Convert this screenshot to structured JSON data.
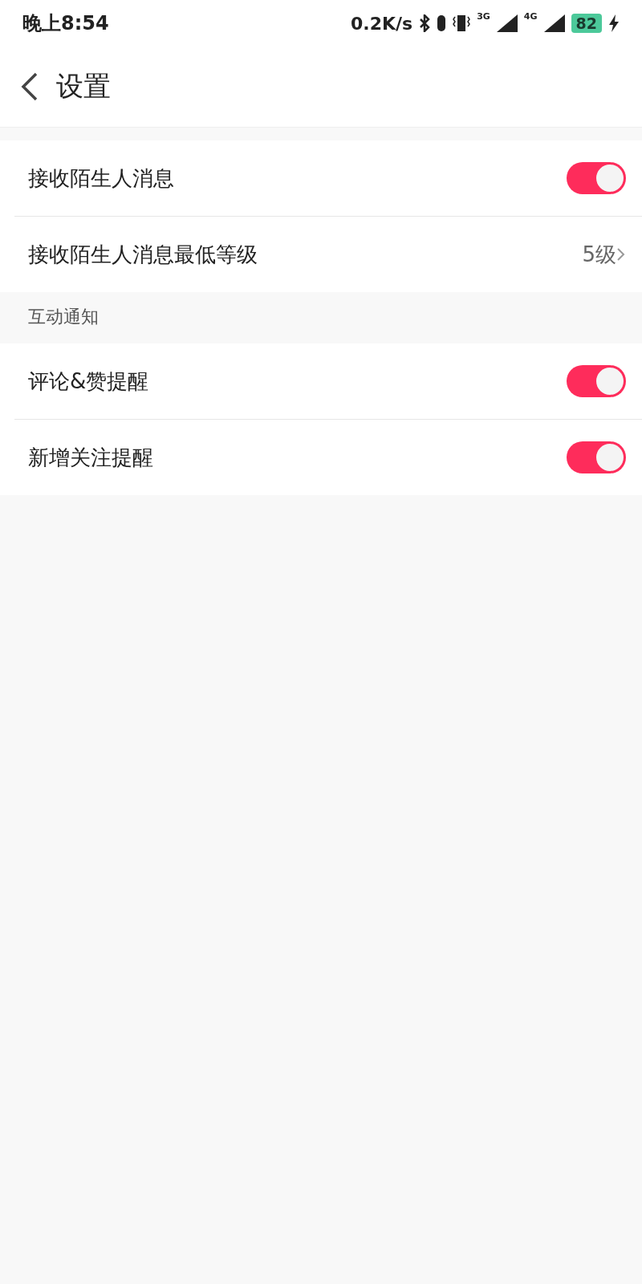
{
  "status_bar": {
    "time": "晚上8:54",
    "speed": "0.2K/s",
    "sim1": "3G",
    "sim2": "4G",
    "battery": "82"
  },
  "header": {
    "title": "设置"
  },
  "groups": [
    {
      "items": [
        {
          "kind": "toggle",
          "label": "接收陌生人消息",
          "on": true
        },
        {
          "kind": "value",
          "label": "接收陌生人消息最低等级",
          "value": "5级"
        }
      ]
    },
    {
      "title": "互动通知",
      "items": [
        {
          "kind": "toggle",
          "label": "评论&赞提醒",
          "on": true
        },
        {
          "kind": "toggle",
          "label": "新增关注提醒",
          "on": true
        }
      ]
    }
  ]
}
